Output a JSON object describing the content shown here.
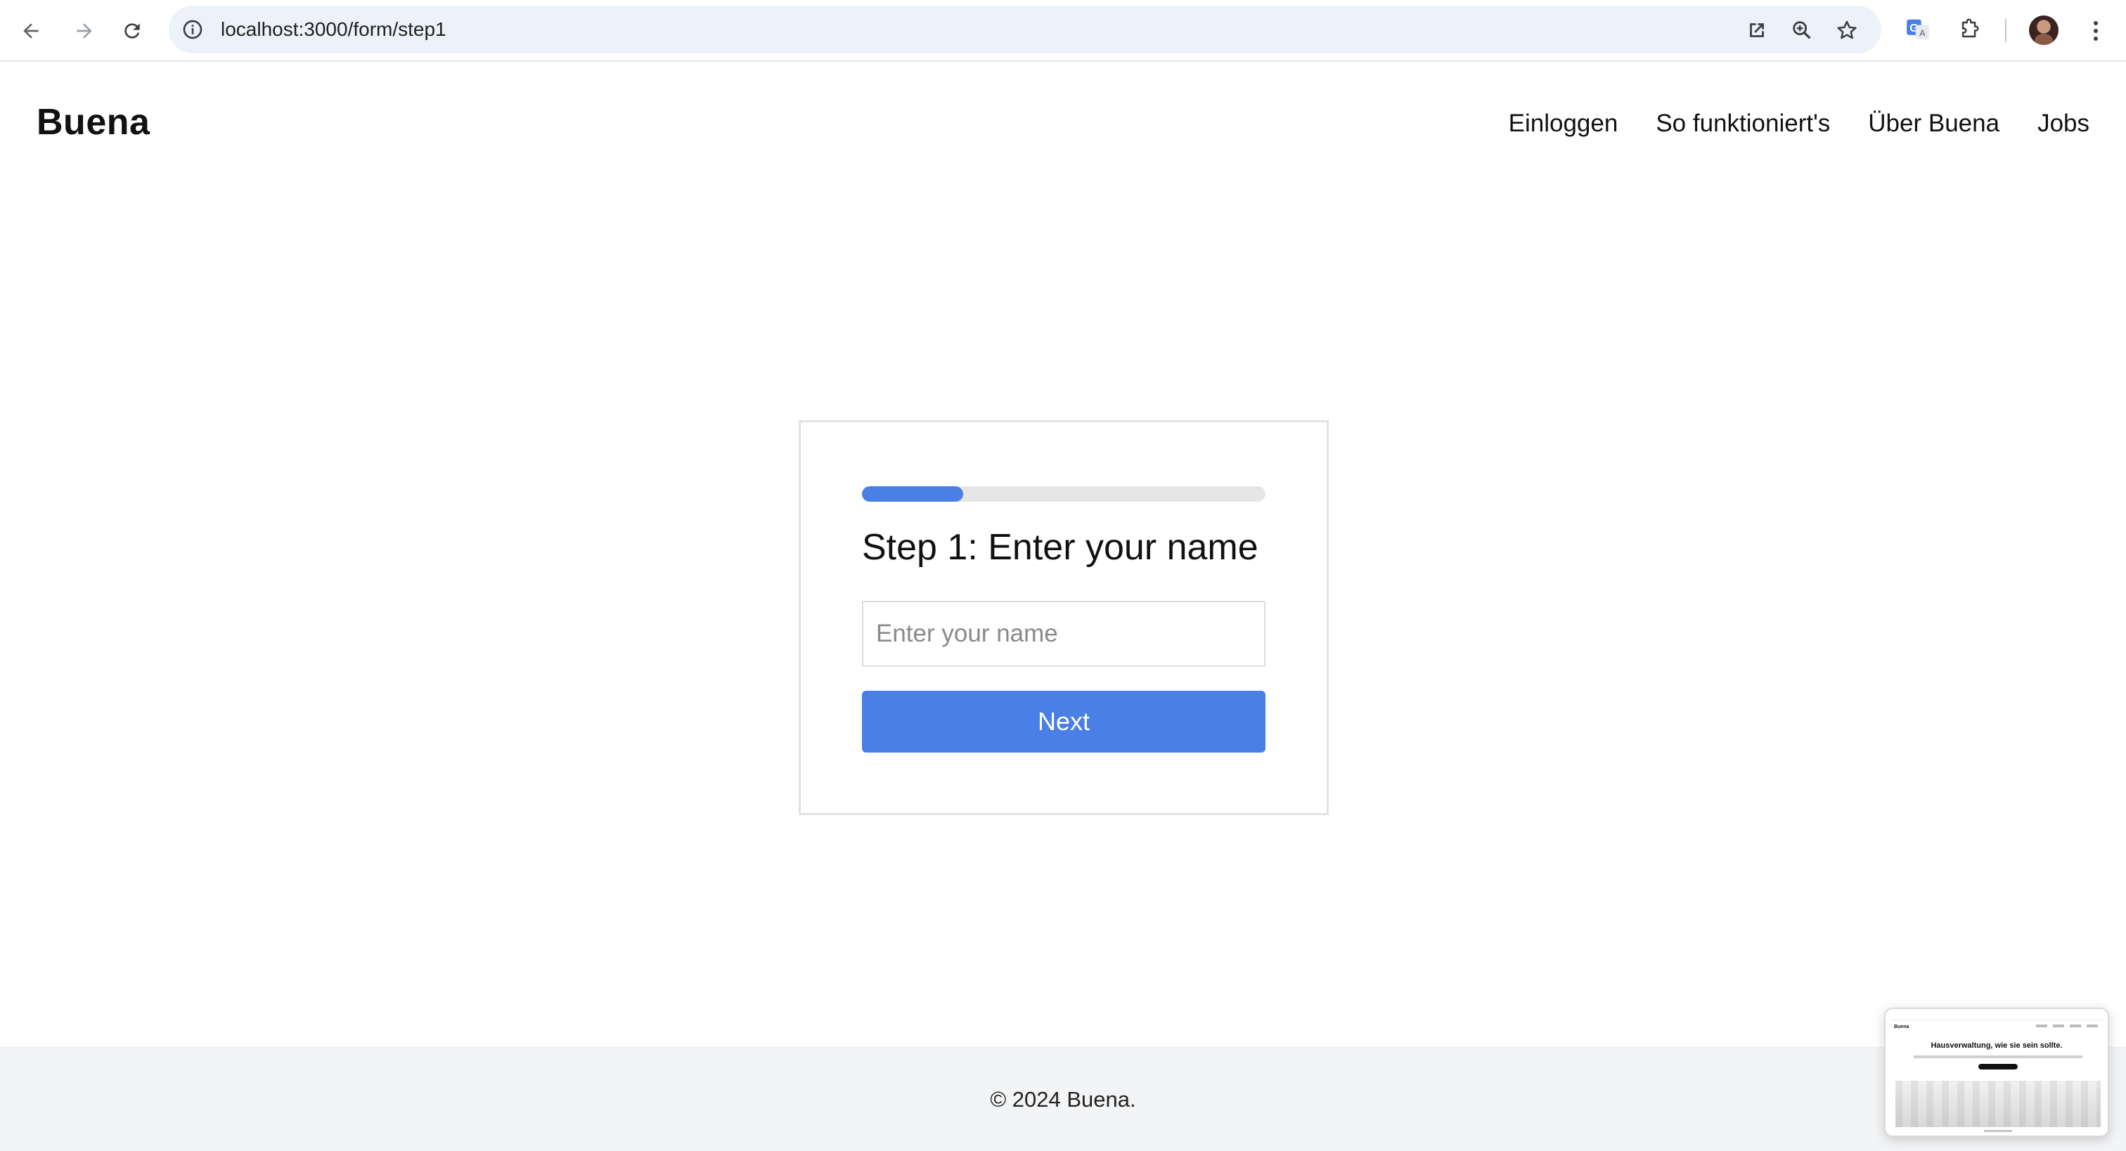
{
  "browser": {
    "url": "localhost:3000/form/step1",
    "icons": {
      "back": "arrow-left-icon",
      "forward": "arrow-right-icon",
      "reload": "reload-icon",
      "site_info": "info-icon",
      "open_in_app": "open-external-icon",
      "zoom": "zoom-icon",
      "bookmark": "star-icon",
      "translate": "translate-icon",
      "extensions": "puzzle-icon",
      "profile": "avatar",
      "menu": "kebab-icon"
    }
  },
  "header": {
    "logo": "Buena",
    "nav": [
      {
        "label": "Einloggen"
      },
      {
        "label": "So funktioniert's"
      },
      {
        "label": "Über Buena"
      },
      {
        "label": "Jobs"
      }
    ]
  },
  "form": {
    "progress": 0.25,
    "title": "Step 1: Enter your name",
    "input_value": "",
    "input_placeholder": "Enter your name",
    "next_label": "Next"
  },
  "footer": {
    "copyright": "© 2024 Buena."
  },
  "tab_preview": {
    "heading": "Hausverwaltung, wie sie sein sollte."
  },
  "colors": {
    "accent": "#4a7fe5",
    "progress_track": "#e6e6e6",
    "footer_bg": "#f3f4f6",
    "omnibox_bg": "#edf2fa"
  }
}
